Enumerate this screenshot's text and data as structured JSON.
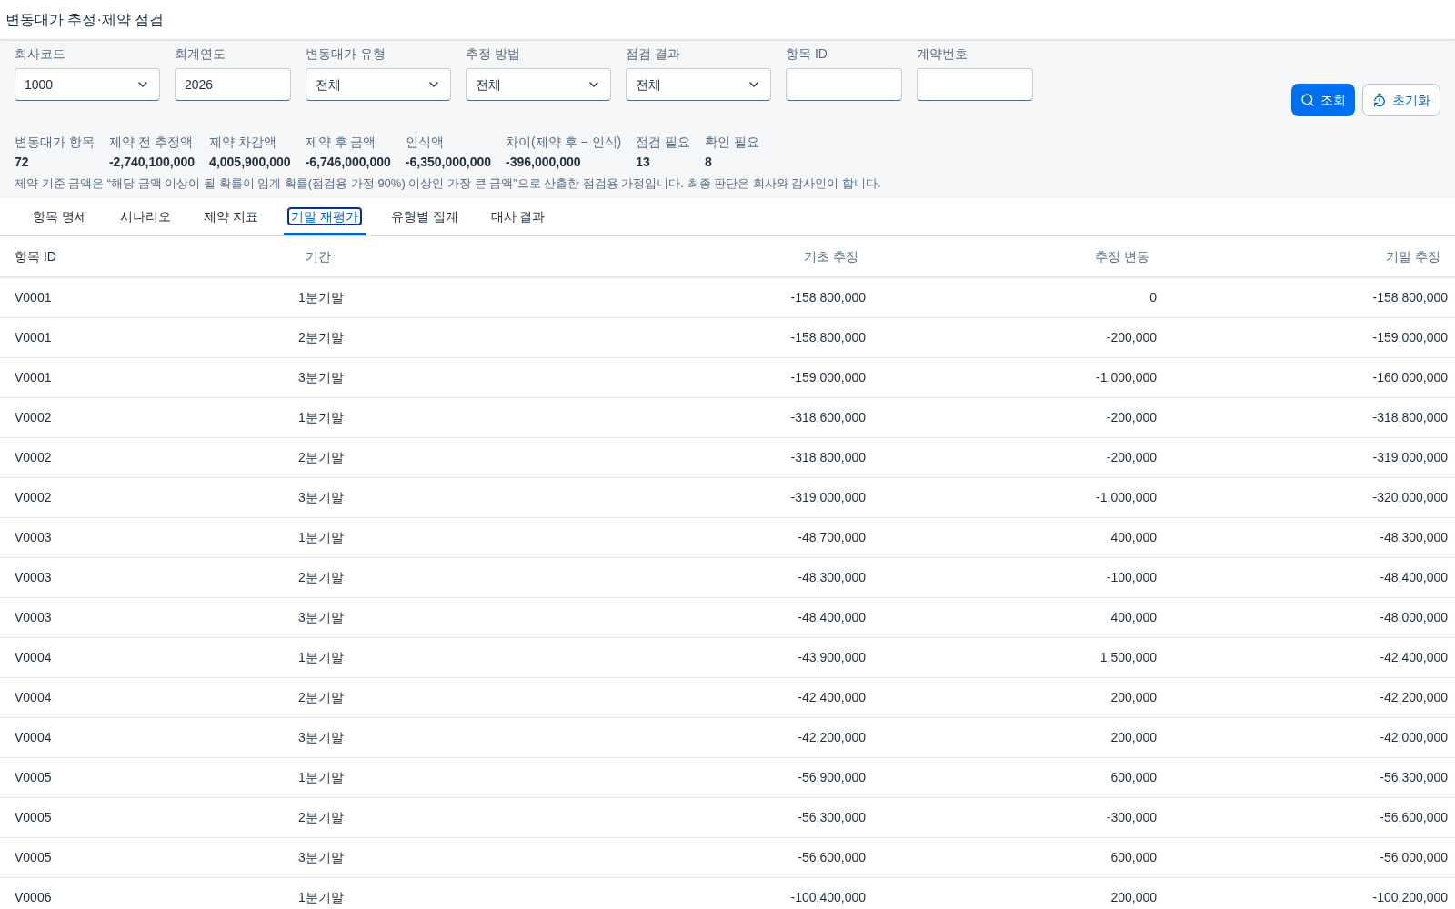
{
  "title": "변동대가 추정·제약 점검",
  "filters": [
    {
      "label": "회사코드",
      "kind": "select",
      "value": "1000"
    },
    {
      "label": "회계연도",
      "kind": "input",
      "value": "2026"
    },
    {
      "label": "변동대가 유형",
      "kind": "select",
      "value": "전체"
    },
    {
      "label": "추정 방법",
      "kind": "select",
      "value": "전체"
    },
    {
      "label": "점검 결과",
      "kind": "select",
      "value": "전체"
    },
    {
      "label": "항목 ID",
      "kind": "input"
    },
    {
      "label": "계약번호",
      "kind": "input"
    }
  ],
  "buttons": [
    {
      "label": "조회",
      "kind": "primary"
    },
    {
      "label": "초기화",
      "kind": "secondary"
    }
  ],
  "summary": [
    {
      "label": "변동대가 항목",
      "value": "72"
    },
    {
      "label": "제약 전 추정액",
      "value": "-2,740,100,000"
    },
    {
      "label": "제약 차감액",
      "value": "4,005,900,000"
    },
    {
      "label": "제약 후 금액",
      "value": "-6,746,000,000"
    },
    {
      "label": "인식액",
      "value": "-6,350,000,000"
    },
    {
      "label": "차이(제약 후 − 인식)",
      "value": "-396,000,000"
    },
    {
      "label": "점검 필요",
      "value": "13"
    },
    {
      "label": "확인 필요",
      "value": "8"
    }
  ],
  "note": "제약 기준 금액은 “해당 금액 이상이 될 확률이 임계 확률(점검용 가정 90%) 이상인 가장 큰 금액”으로 산출한 점검용 가정입니다. 최종 판단은 회사와 감사인이 합니다.",
  "tabs": [
    {
      "label": "항목 명세",
      "selected": false
    },
    {
      "label": "시나리오",
      "selected": false
    },
    {
      "label": "제약 지표",
      "selected": false
    },
    {
      "label": "기말 재평가",
      "selected": true
    },
    {
      "label": "유형별 집계",
      "selected": false
    },
    {
      "label": "대사 결과",
      "selected": false
    }
  ],
  "table": {
    "columns": [
      "항목 ID",
      "기간",
      "기초 추정",
      "추정 변동",
      "기말 추정"
    ],
    "rows": [
      [
        "V0001",
        "1분기말",
        "-158,800,000",
        "0",
        "-158,800,000"
      ],
      [
        "V0001",
        "2분기말",
        "-158,800,000",
        "-200,000",
        "-159,000,000"
      ],
      [
        "V0001",
        "3분기말",
        "-159,000,000",
        "-1,000,000",
        "-160,000,000"
      ],
      [
        "V0002",
        "1분기말",
        "-318,600,000",
        "-200,000",
        "-318,800,000"
      ],
      [
        "V0002",
        "2분기말",
        "-318,800,000",
        "-200,000",
        "-319,000,000"
      ],
      [
        "V0002",
        "3분기말",
        "-319,000,000",
        "-1,000,000",
        "-320,000,000"
      ],
      [
        "V0003",
        "1분기말",
        "-48,700,000",
        "400,000",
        "-48,300,000"
      ],
      [
        "V0003",
        "2분기말",
        "-48,300,000",
        "-100,000",
        "-48,400,000"
      ],
      [
        "V0003",
        "3분기말",
        "-48,400,000",
        "400,000",
        "-48,000,000"
      ],
      [
        "V0004",
        "1분기말",
        "-43,900,000",
        "1,500,000",
        "-42,400,000"
      ],
      [
        "V0004",
        "2분기말",
        "-42,400,000",
        "200,000",
        "-42,200,000"
      ],
      [
        "V0004",
        "3분기말",
        "-42,200,000",
        "200,000",
        "-42,000,000"
      ],
      [
        "V0005",
        "1분기말",
        "-56,900,000",
        "600,000",
        "-56,300,000"
      ],
      [
        "V0005",
        "2분기말",
        "-56,300,000",
        "-300,000",
        "-56,600,000"
      ],
      [
        "V0005",
        "3분기말",
        "-56,600,000",
        "600,000",
        "-56,000,000"
      ],
      [
        "V0006",
        "1분기말",
        "-100,400,000",
        "200,000",
        "-100,200,000"
      ]
    ]
  }
}
